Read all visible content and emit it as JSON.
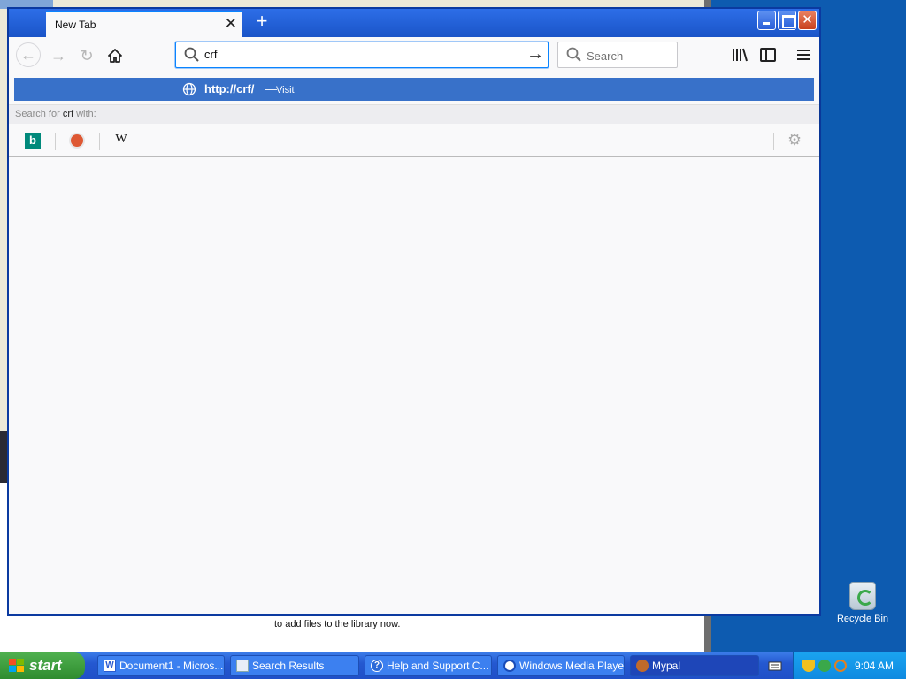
{
  "browser": {
    "tab_title": "New Tab",
    "url_value": "crf",
    "search_placeholder": "Search"
  },
  "dropdown": {
    "result_url": "http://crf/",
    "result_separator": "—",
    "result_action": "Visit",
    "search_for_prefix": "Search for",
    "search_term": "crf",
    "search_for_suffix": "with:",
    "engines": [
      "bing-icon",
      "duckduckgo-icon",
      "wikipedia-icon"
    ]
  },
  "background_window": {
    "text": "to add files to the library now."
  },
  "desktop": {
    "recycle_bin_label": "Recycle Bin"
  },
  "taskbar": {
    "start_label": "start",
    "tasks": [
      {
        "label": "Document1 - Micros..."
      },
      {
        "label": "Search Results"
      },
      {
        "label": "Help and Support C..."
      },
      {
        "label": "Windows Media Player"
      },
      {
        "label": "Mypal"
      }
    ],
    "clock": "9:04 AM"
  },
  "colors": {
    "accent": "#0a84ff",
    "selected_result": "#3871c9",
    "desktop": "#0d5bb0"
  }
}
